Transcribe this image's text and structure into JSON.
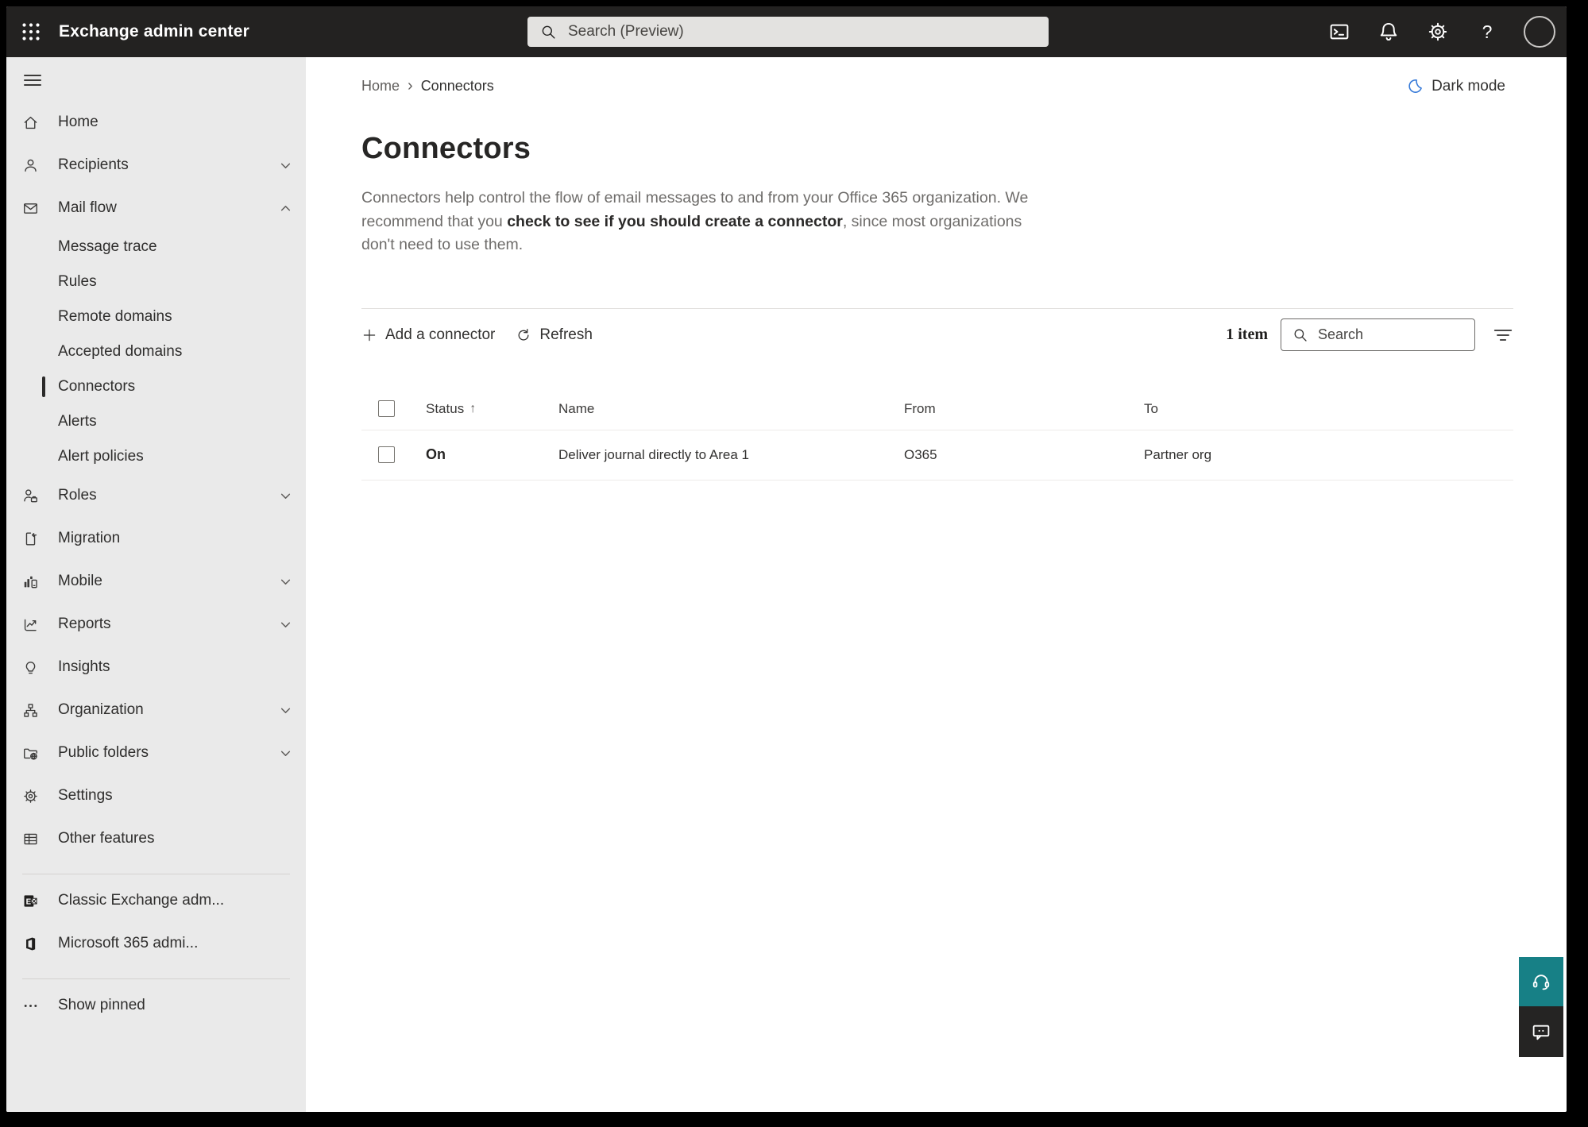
{
  "topbar": {
    "app_title": "Exchange admin center",
    "search_placeholder": "Search (Preview)",
    "icons": [
      "waffle-icon",
      "terminal-icon",
      "bell-icon",
      "gear-icon",
      "help-icon",
      "avatar-ring"
    ]
  },
  "theme": {
    "topbar_bg": "#232221",
    "sidebar_bg": "#eaeaea",
    "accent_blue": "#3579d8",
    "support_teal": "#178086",
    "feedback_dark": "#252423"
  },
  "sidebar": {
    "items": [
      {
        "label": "Home",
        "icon": "home-icon",
        "type": "main"
      },
      {
        "label": "Recipients",
        "icon": "person-icon",
        "type": "main",
        "chevron": "down"
      },
      {
        "label": "Mail flow",
        "icon": "mail-icon",
        "type": "main",
        "chevron": "up",
        "expanded": true
      },
      {
        "label": "Message trace",
        "type": "sub"
      },
      {
        "label": "Rules",
        "type": "sub"
      },
      {
        "label": "Remote domains",
        "type": "sub"
      },
      {
        "label": "Accepted domains",
        "type": "sub"
      },
      {
        "label": "Connectors",
        "type": "sub",
        "selected": true
      },
      {
        "label": "Alerts",
        "type": "sub"
      },
      {
        "label": "Alert policies",
        "type": "sub"
      },
      {
        "label": "Roles",
        "icon": "person-briefcase-icon",
        "type": "main",
        "chevron": "down"
      },
      {
        "label": "Migration",
        "icon": "document-arrow-icon",
        "type": "main"
      },
      {
        "label": "Mobile",
        "icon": "chart-phone-icon",
        "type": "main",
        "chevron": "down"
      },
      {
        "label": "Reports",
        "icon": "trending-icon",
        "type": "main",
        "chevron": "down"
      },
      {
        "label": "Insights",
        "icon": "lightbulb-icon",
        "type": "main"
      },
      {
        "label": "Organization",
        "icon": "org-chart-icon",
        "type": "main",
        "chevron": "down"
      },
      {
        "label": "Public folders",
        "icon": "folder-globe-icon",
        "type": "main",
        "chevron": "down"
      },
      {
        "label": "Settings",
        "icon": "gear-icon",
        "type": "main"
      },
      {
        "label": "Other features",
        "icon": "table-icon",
        "type": "main"
      },
      {
        "label": "Classic Exchange adm...",
        "icon": "exchange-logo-icon",
        "type": "footer"
      },
      {
        "label": "Microsoft 365 admi...",
        "icon": "office-logo-icon",
        "type": "footer"
      },
      {
        "label": "Show pinned",
        "icon": "ellipsis-icon",
        "type": "footer"
      }
    ]
  },
  "breadcrumb": {
    "home": "Home",
    "separator": "›",
    "current": "Connectors"
  },
  "dark_mode": {
    "label": "Dark mode",
    "icon": "crescent-moon-icon"
  },
  "page": {
    "title": "Connectors",
    "desc_part1": "Connectors help control the flow of email messages to and from your Office 365 organization. We recommend that you ",
    "desc_link": "check to see if you should create a connector",
    "desc_part2": ", since most organizations don't need to use them."
  },
  "toolbar": {
    "add_label": "Add a connector",
    "refresh_label": "Refresh",
    "item_count": "1 item",
    "search_placeholder": "Search"
  },
  "table": {
    "columns": [
      "Status",
      "Name",
      "From",
      "To"
    ],
    "sort_arrow": "↑",
    "rows": [
      {
        "status": "On",
        "name": "Deliver journal directly to Area 1",
        "from": "O365",
        "to": "Partner org"
      }
    ]
  }
}
